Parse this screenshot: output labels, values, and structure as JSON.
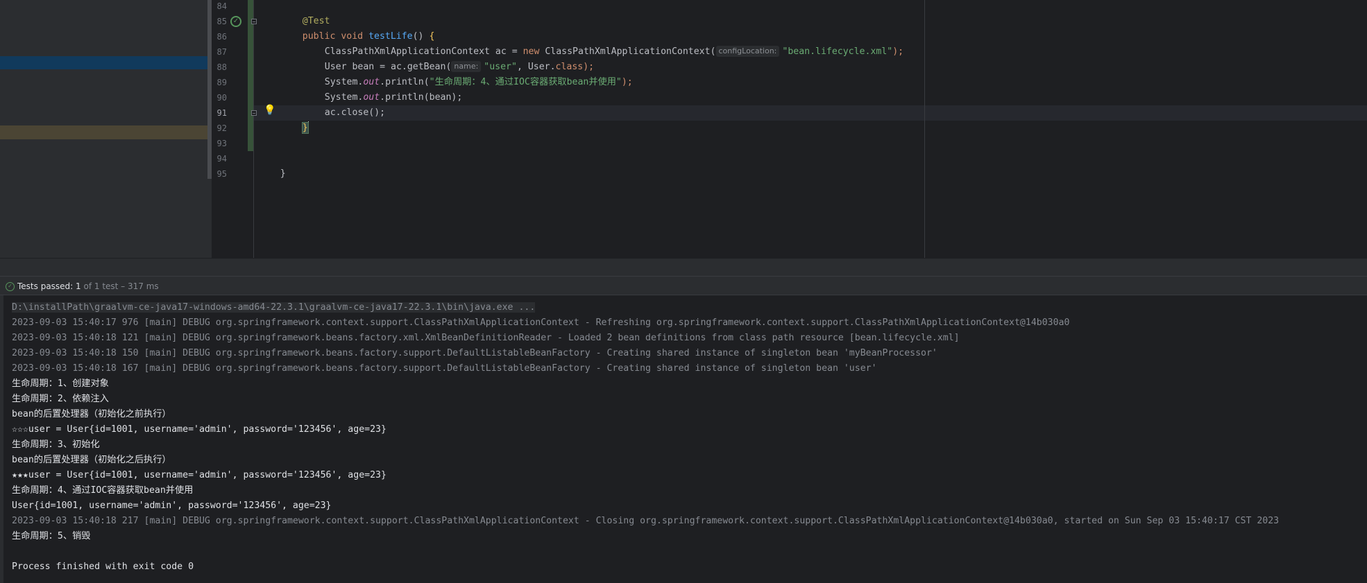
{
  "project_panel": {},
  "editor": {
    "line_numbers": [
      "84",
      "85",
      "86",
      "87",
      "88",
      "89",
      "90",
      "91",
      "92",
      "93",
      "94",
      "95"
    ],
    "line84": {
      "annotation": "@Test"
    },
    "line85": {
      "kw_public": "public",
      "kw_void": "void",
      "method_name": "testLife",
      "parens": "() ",
      "brace": "{"
    },
    "line86": {
      "type": "ClassPathXmlApplicationContext",
      "var": " ac = ",
      "kw_new": "new",
      "ctor": " ClassPathXmlApplicationContext(",
      "hint": "configLocation:",
      "arg": "\"bean.lifecycle.xml\"",
      "end": ");"
    },
    "line87": {
      "pre": "User bean = ac.",
      "method": "getBean",
      "open": "(",
      "hint": "name:",
      "arg": "\"user\"",
      "mid": ", User.",
      "kw_class": "class",
      "end": ");"
    },
    "line88": {
      "pre": "System.",
      "out": "out",
      "mid": ".println(",
      "arg": "\"生命周期：4、通过IOC容器获取bean并使用\"",
      "end": ");"
    },
    "line89": {
      "pre": "System.",
      "out": "out",
      "mid": ".println(bean);"
    },
    "line90": {
      "text": "ac.close();"
    },
    "line91": {
      "brace": "}"
    },
    "line94": {
      "brace": "}"
    }
  },
  "run_window": {
    "status_label": "Tests passed: ",
    "status_count": "1",
    "status_extra": " of 1 test – 317 ms",
    "console_lines": [
      {
        "type": "cmd",
        "text": "D:\\installPath\\graalvm-ce-java17-windows-amd64-22.3.1\\graalvm-ce-java17-22.3.1\\bin\\java.exe ..."
      },
      {
        "type": "debug",
        "text": "2023-09-03 15:40:17 976 [main] DEBUG org.springframework.context.support.ClassPathXmlApplicationContext - Refreshing org.springframework.context.support.ClassPathXmlApplicationContext@14b030a0"
      },
      {
        "type": "debug",
        "text": "2023-09-03 15:40:18 121 [main] DEBUG org.springframework.beans.factory.xml.XmlBeanDefinitionReader - Loaded 2 bean definitions from class path resource [bean.lifecycle.xml]"
      },
      {
        "type": "debug",
        "text": "2023-09-03 15:40:18 150 [main] DEBUG org.springframework.beans.factory.support.DefaultListableBeanFactory - Creating shared instance of singleton bean 'myBeanProcessor'"
      },
      {
        "type": "debug",
        "text": "2023-09-03 15:40:18 167 [main] DEBUG org.springframework.beans.factory.support.DefaultListableBeanFactory - Creating shared instance of singleton bean 'user'"
      },
      {
        "type": "out",
        "text": "生命周期：1、创建对象"
      },
      {
        "type": "out",
        "text": "生命周期：2、依赖注入"
      },
      {
        "type": "out",
        "text": "bean的后置处理器（初始化之前执行）"
      },
      {
        "type": "out",
        "text": "☆☆☆user = User{id=1001, username='admin', password='123456', age=23}"
      },
      {
        "type": "out",
        "text": "生命周期：3、初始化"
      },
      {
        "type": "out",
        "text": "bean的后置处理器（初始化之后执行）"
      },
      {
        "type": "out",
        "text": "★★★user = User{id=1001, username='admin', password='123456', age=23}"
      },
      {
        "type": "out",
        "text": "生命周期：4、通过IOC容器获取bean并使用"
      },
      {
        "type": "out",
        "text": "User{id=1001, username='admin', password='123456', age=23}"
      },
      {
        "type": "debug",
        "text": "2023-09-03 15:40:18 217 [main] DEBUG org.springframework.context.support.ClassPathXmlApplicationContext - Closing org.springframework.context.support.ClassPathXmlApplicationContext@14b030a0, started on Sun Sep 03 15:40:17 CST 2023"
      },
      {
        "type": "out",
        "text": "生命周期：5、销毁"
      },
      {
        "type": "out",
        "text": ""
      },
      {
        "type": "out",
        "text": "Process finished with exit code 0"
      }
    ]
  }
}
